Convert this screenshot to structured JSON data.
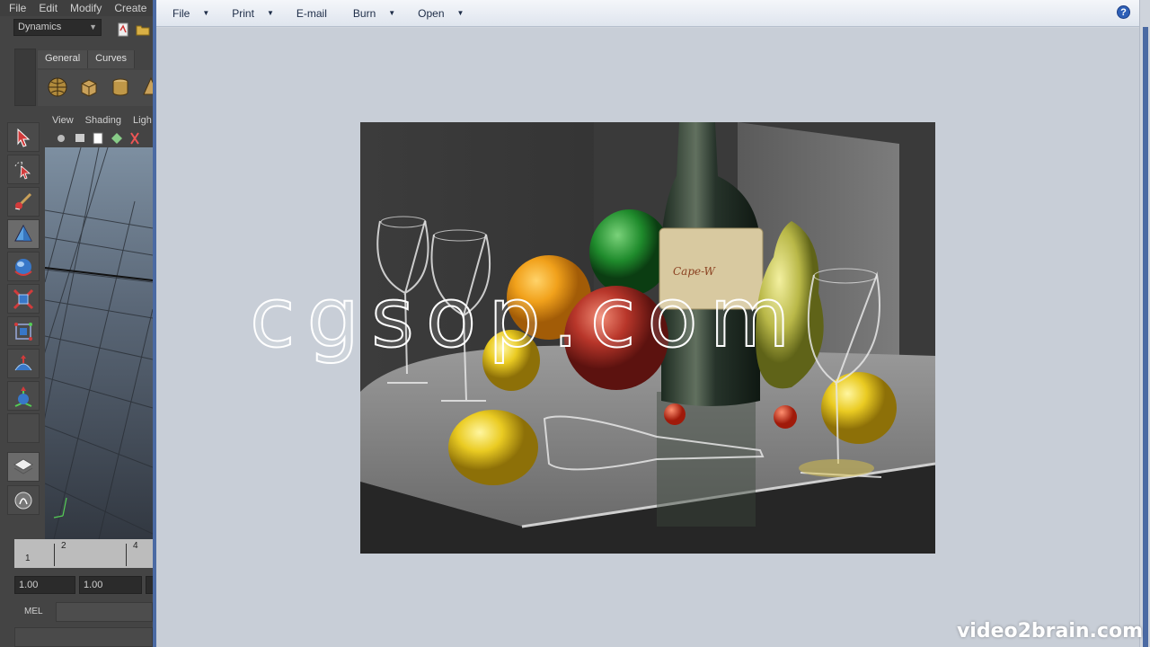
{
  "maya": {
    "menu": [
      "File",
      "Edit",
      "Modify",
      "Create"
    ],
    "mode_menu": "Dynamics",
    "shelf_tabs": [
      "General",
      "Curves"
    ],
    "viewport_menu": [
      "View",
      "Shading",
      "Ligh"
    ],
    "timeline_labels": [
      "2",
      "4",
      "1"
    ],
    "range_start": "1.00",
    "range_end": "1.00",
    "mel_label": "MEL"
  },
  "viewer": {
    "toolbar": [
      "File",
      "Print",
      "E-mail",
      "Burn",
      "Open"
    ],
    "help_label": "?"
  },
  "watermark": "cgsop.com",
  "brand": "video2brain.com",
  "colors": {
    "window_accent": "#4b6aa3",
    "window_body": "#c8ced7",
    "maya_panel": "#444444"
  },
  "icons": [
    "file-icon",
    "folder-icon",
    "select-arrow-icon",
    "lasso-icon",
    "paint-icon",
    "move-icon",
    "rotate-icon",
    "scale-icon",
    "universal-manipulator-icon",
    "soft-mod-icon",
    "show-manipulator-icon",
    "layout-icon",
    "outliner-icon",
    "help-icon"
  ]
}
